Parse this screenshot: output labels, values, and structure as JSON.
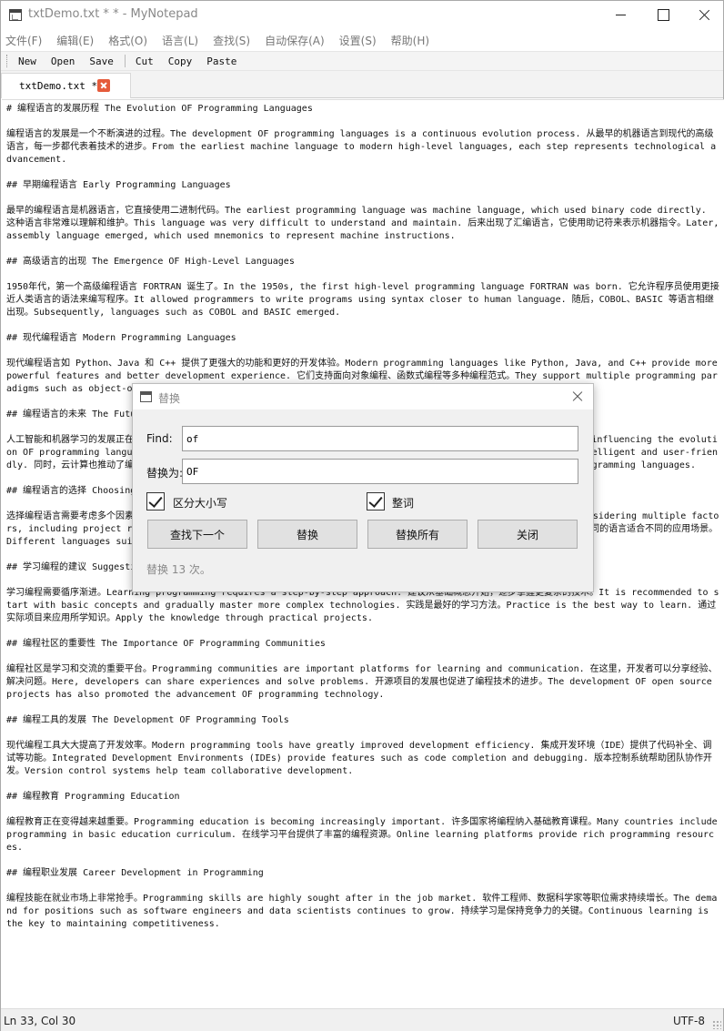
{
  "window": {
    "title": "txtDemo.txt * * - MyNotepad"
  },
  "menu": [
    "文件(F)",
    "编辑(E)",
    "格式(O)",
    "语言(L)",
    "查找(S)",
    "自动保存(A)",
    "设置(S)",
    "帮助(H)"
  ],
  "toolbar": {
    "new_label": "New",
    "open_label": "Open",
    "save_label": "Save",
    "cut_label": "Cut",
    "copy_label": "Copy",
    "paste_label": "Paste"
  },
  "tab": {
    "label": "txtDemo.txt *"
  },
  "editor": {
    "lines": [
      "# 编程语言的发展历程 The Evolution OF Programming Languages",
      "",
      "编程语言的发展是一个不断演进的过程。The development OF programming languages is a continuous evolution process. 从最早的机器语言到现代的高级语言，每一步都代表着技术的进步。From the earliest machine language to modern high-level languages, each step represents technological advancement.",
      "",
      "## 早期编程语言 Early Programming Languages",
      "",
      "最早的编程语言是机器语言，它直接使用二进制代码。The earliest programming language was machine language, which used binary code directly. 这种语言非常难以理解和维护。This language was very difficult to understand and maintain. 后来出现了汇编语言，它使用助记符来表示机器指令。Later, assembly language emerged, which used mnemonics to represent machine instructions.",
      "",
      "## 高级语言的出现 The Emergence OF High-Level Languages",
      "",
      "1950年代，第一个高级编程语言 FORTRAN 诞生了。In the 1950s, the first high-level programming language FORTRAN was born. 它允许程序员使用更接近人类语言的语法来编写程序。It allowed programmers to write programs using syntax closer to human language. 随后，COBOL、BASIC 等语言相继出现。Subsequently, languages such as COBOL and BASIC emerged.",
      "",
      "## 现代编程语言 Modern Programming Languages",
      "",
      "现代编程语言如 Python、Java 和 C++ 提供了更强大的功能和更好的开发体验。Modern programming languages like Python, Java, and C++ provide more powerful features and better development experience. 它们支持面向对象编程、函数式编程等多种编程范式。They support multiple programming paradigms such as object-oriented and functional programming.",
      "",
      "## 编程语言的未来 The Future OF Programming Languages",
      "",
      "人工智能和机器学习的发展正在影响编程语言的演变。The development of artificial intelligence and machine learning is influencing the evolution OF programming languages. 未来的编程语言可能会更加智能和易用。Future programming languages may become more intelligent and user-friendly. 同时，云计算也推动了编程语言的发展。At the same time, cloud computing has also driven the development OF programming languages.",
      "",
      "## 编程语言的选择 Choosing a Programming Language",
      "",
      "选择编程语言需要考虑多个因素，包括项目需求、开发团队的技术背景、性能要求等。Choosing a programming language requires considering multiple factors, including project requirements, development team technical background, and performance requirements. 不同的语言适合不同的应用场景。Different languages suit different application scenarios.",
      "",
      "## 学习编程的建议 Suggestions for Learning Programming",
      "",
      "学习编程需要循序渐进。Learning programming requires a step-by-step approach. 建议从基础概念开始，逐步掌握更复杂的技术。It is recommended to start with basic concepts and gradually master more complex technologies. 实践是最好的学习方法。Practice is the best way to learn. 通过实际项目来应用所学知识。Apply the knowledge through practical projects.",
      "",
      "## 编程社区的重要性 The Importance OF Programming Communities",
      "",
      "编程社区是学习和交流的重要平台。Programming communities are important platforms for learning and communication. 在这里，开发者可以分享经验、解决问题。Here, developers can share experiences and solve problems. 开源项目的发展也促进了编程技术的进步。The development OF open source projects has also promoted the advancement OF programming technology.",
      "",
      "## 编程工具的发展 The Development OF Programming Tools",
      "",
      "现代编程工具大大提高了开发效率。Modern programming tools have greatly improved development efficiency. 集成开发环境（IDE）提供了代码补全、调试等功能。Integrated Development Environments (IDEs) provide features such as code completion and debugging. 版本控制系统帮助团队协作开发。Version control systems help team collaborative development.",
      "",
      "## 编程教育 Programming Education",
      "",
      "编程教育正在变得越来越重要。Programming education is becoming increasingly important. 许多国家将编程纳入基础教育课程。Many countries include programming in basic education curriculum. 在线学习平台提供了丰富的编程资源。Online learning platforms provide rich programming resources.",
      "",
      "## 编程职业发展 Career Development in Programming",
      "",
      "编程技能在就业市场上非常抢手。Programming skills are highly sought after in the job market. 软件工程师、数据科学家等职位需求持续增长。The demand for positions such as software engineers and data scientists continues to grow. 持续学习是保持竞争力的关键。Continuous learning is the key to maintaining competitiveness."
    ]
  },
  "status": {
    "position": "Ln 33, Col 30",
    "encoding": "UTF-8"
  },
  "replace_dialog": {
    "title": "替换",
    "find_label": "Find:",
    "find_value": "of",
    "replace_label": "替换为:",
    "replace_value": "OF",
    "match_case_label": "区分大小写",
    "match_case_checked": true,
    "whole_word_label": "整词",
    "whole_word_checked": true,
    "find_next_label": "查找下一个",
    "replace_label_btn": "替换",
    "replace_all_label": "替换所有",
    "close_label": "关闭",
    "status_text": "替换 13 次。"
  }
}
